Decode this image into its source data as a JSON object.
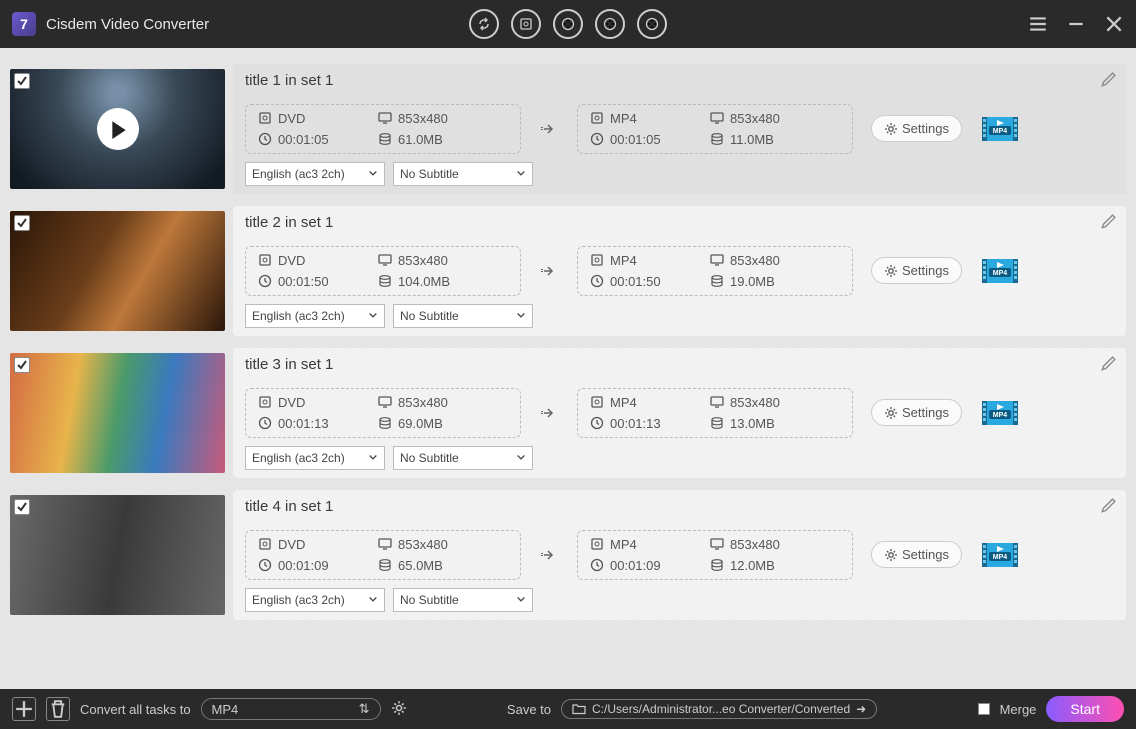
{
  "app": {
    "name": "Cisdem Video Converter"
  },
  "titlebar_icons": [
    "convert-icon",
    "disc-icon",
    "media-add-icon",
    "media-edit-icon",
    "media-grid-icon"
  ],
  "rows": [
    {
      "title": "title 1 in set 1",
      "src": {
        "format": "DVD",
        "resolution": "853x480",
        "duration": "00:01:05",
        "size": "61.0MB"
      },
      "dst": {
        "format": "MP4",
        "resolution": "853x480",
        "duration": "00:01:05",
        "size": "11.0MB"
      },
      "audio": "English (ac3 2ch)",
      "subtitle": "No Subtitle",
      "selected": true,
      "show_play": true,
      "thumb_bg": "radial-gradient(circle at 50% 20%, #7790a8 5%, #3a4a58 40%, #121a22 90%)"
    },
    {
      "title": "title 2 in set 1",
      "src": {
        "format": "DVD",
        "resolution": "853x480",
        "duration": "00:01:50",
        "size": "104.0MB"
      },
      "dst": {
        "format": "MP4",
        "resolution": "853x480",
        "duration": "00:01:50",
        "size": "19.0MB"
      },
      "audio": "English (ac3 2ch)",
      "subtitle": "No Subtitle",
      "selected": false,
      "show_play": false,
      "thumb_bg": "linear-gradient(120deg, #2a1608 0%, #6b3e1a 40%, #bd783a 60%, #2a160a 100%)"
    },
    {
      "title": "title 3 in set 1",
      "src": {
        "format": "DVD",
        "resolution": "853x480",
        "duration": "00:01:13",
        "size": "69.0MB"
      },
      "dst": {
        "format": "MP4",
        "resolution": "853x480",
        "duration": "00:01:13",
        "size": "13.0MB"
      },
      "audio": "English (ac3 2ch)",
      "subtitle": "No Subtitle",
      "selected": false,
      "show_play": false,
      "thumb_bg": "linear-gradient(100deg, #d36b44 0%, #e8b44a 30%, #4a9a6a 50%, #3a7abf 70%, #c85a7a 100%)"
    },
    {
      "title": "title 4 in set 1",
      "src": {
        "format": "DVD",
        "resolution": "853x480",
        "duration": "00:01:09",
        "size": "65.0MB"
      },
      "dst": {
        "format": "MP4",
        "resolution": "853x480",
        "duration": "00:01:09",
        "size": "12.0MB"
      },
      "audio": "English (ac3 2ch)",
      "subtitle": "No Subtitle",
      "selected": false,
      "show_play": false,
      "thumb_bg": "linear-gradient(100deg, #6a6a6a 0%, #3a3a3a 50%, #666 100%)"
    }
  ],
  "settings_label": "Settings",
  "bottom": {
    "convert_label": "Convert all tasks to",
    "format": "MP4",
    "save_label": "Save to",
    "path": "C:/Users/Administrator...eo Converter/Converted",
    "merge_label": "Merge",
    "start_label": "Start"
  }
}
